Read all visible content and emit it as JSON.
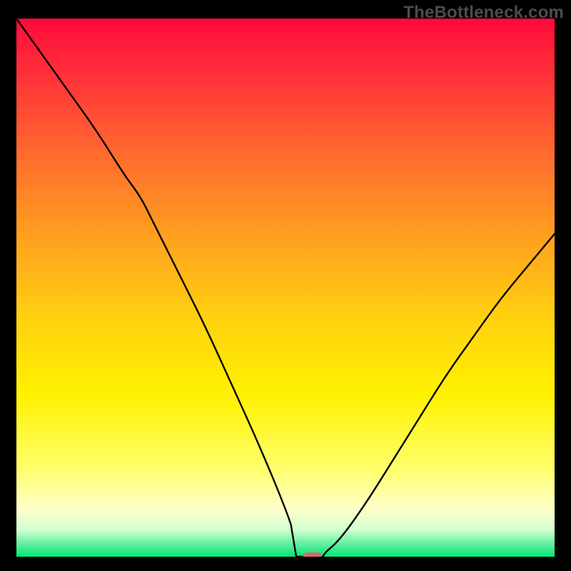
{
  "watermark": "TheBottleneck.com",
  "chart_data": {
    "type": "line",
    "title": "",
    "xlabel": "",
    "ylabel": "",
    "xlim": [
      0,
      100
    ],
    "ylim": [
      0,
      100
    ],
    "colors": {
      "gradient_top": "#ff0a3a",
      "gradient_mid_warm": "#ffb300",
      "gradient_mid_yellow": "#fff200",
      "gradient_pale": "#ffffc8",
      "gradient_green": "#00e574",
      "curve": "#000000",
      "marker": "#d46a6a"
    },
    "series": [
      {
        "name": "bottleneck-curve",
        "x": [
          0,
          5,
          10,
          15,
          20,
          23,
          25,
          30,
          35,
          40,
          45,
          50,
          52,
          54,
          55,
          57,
          60,
          65,
          70,
          75,
          80,
          85,
          90,
          95,
          100
        ],
        "y": [
          100,
          93,
          86,
          79,
          71,
          67,
          63,
          53,
          43,
          32,
          21,
          9,
          3,
          0.5,
          0,
          0.5,
          3,
          10,
          18,
          26,
          34,
          41,
          48,
          54,
          60
        ]
      }
    ],
    "flat_segment": {
      "x_start": 52,
      "x_end": 57,
      "y": 0
    },
    "marker": {
      "x": 55,
      "y": 0,
      "shape": "rounded-rect"
    }
  }
}
